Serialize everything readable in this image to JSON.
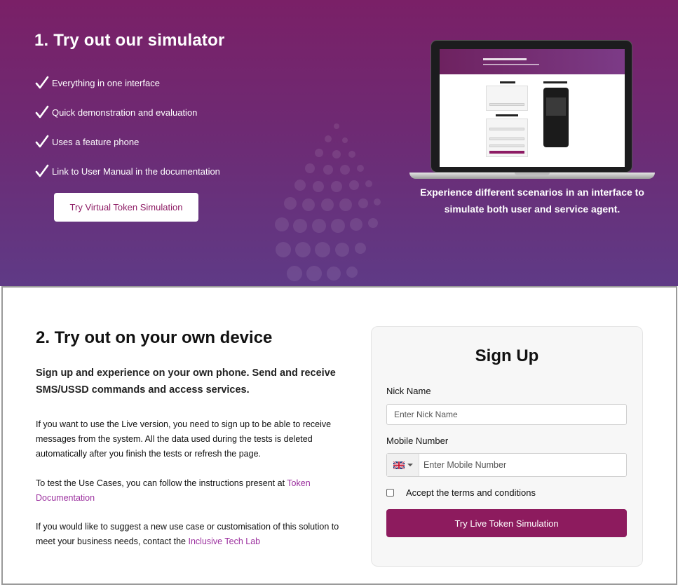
{
  "hero": {
    "title": "1. Try out our simulator",
    "features": [
      "Everything in one interface",
      "Quick demonstration and evaluation",
      "Uses a feature phone",
      "Link to User Manual in the documentation"
    ],
    "cta_label": "Try Virtual Token Simulation",
    "caption": "Experience different scenarios in an interface to simulate both user and service agent.",
    "background_colors": [
      "#7a2067",
      "#5f3a86"
    ]
  },
  "section2": {
    "title": "2. Try out on your own device",
    "lead": "Sign up and experience on your own phone. Send and receive SMS/USSD commands and access services.",
    "paragraph1": "If you want to use the Live version, you need to sign up to be able to receive messages from the system. All the data used during the tests is deleted automatically after you finish the tests or refresh the page.",
    "paragraph2_text": "To test the Use Cases, you can follow the instructions present at ",
    "paragraph2_link": "Token Documentation",
    "paragraph3_text": "If you would like to suggest a new use case or customisation of this solution to meet your business needs, contact the ",
    "paragraph3_link": "Inclusive Tech Lab",
    "link_color": "#9b2f9e"
  },
  "signup": {
    "title": "Sign Up",
    "nick_label": "Nick Name",
    "nick_placeholder": "Enter Nick Name",
    "mobile_label": "Mobile Number",
    "mobile_placeholder": "Enter Mobile Number",
    "country_flag": "uk-flag-icon",
    "terms_label": "Accept the terms and conditions",
    "submit_label": "Try Live Token Simulation",
    "accent_color": "#8d1b5e"
  }
}
